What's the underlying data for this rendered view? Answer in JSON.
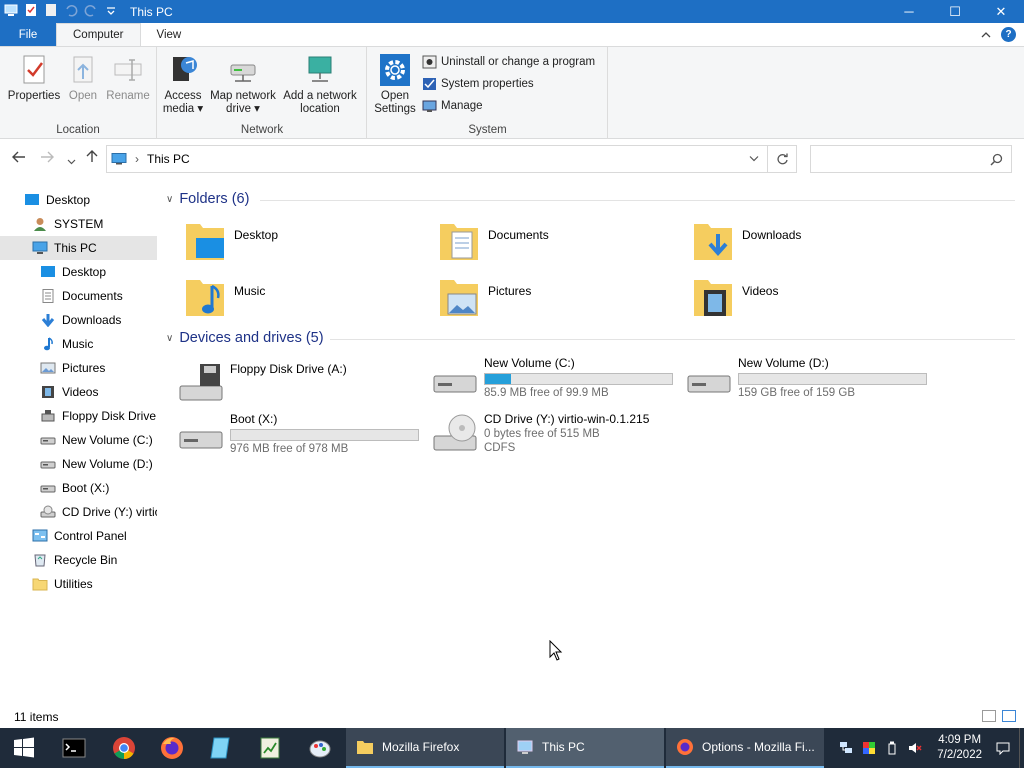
{
  "window": {
    "title": "This PC",
    "controls": {
      "minimize": "─",
      "maximize": "☐",
      "close": "✕"
    }
  },
  "ribbon": {
    "tabs": [
      {
        "label": "File"
      },
      {
        "label": "Computer"
      },
      {
        "label": "View"
      }
    ],
    "groups": {
      "location": {
        "label": "Location",
        "properties": "Properties",
        "open": "Open",
        "rename": "Rename"
      },
      "network": {
        "label": "Network",
        "access_media": [
          "Access",
          "media"
        ],
        "map_network_drive": [
          "Map network",
          "drive"
        ],
        "add_network_location": [
          "Add a network",
          "location"
        ]
      },
      "system": {
        "label": "System",
        "open_settings": [
          "Open",
          "Settings"
        ],
        "uninstall": "Uninstall or change a program",
        "system_properties": "System properties",
        "manage": "Manage"
      }
    }
  },
  "address": {
    "path": "This PC",
    "search_placeholder": ""
  },
  "nav_pane": {
    "items": [
      {
        "label": "Desktop",
        "icon": "desktop-icon"
      },
      {
        "label": "SYSTEM",
        "icon": "user-icon"
      },
      {
        "label": "This PC",
        "icon": "pc-icon",
        "selected": true
      },
      {
        "label": "Desktop",
        "icon": "desktop-icon"
      },
      {
        "label": "Documents",
        "icon": "documents-icon"
      },
      {
        "label": "Downloads",
        "icon": "downloads-icon"
      },
      {
        "label": "Music",
        "icon": "music-icon"
      },
      {
        "label": "Pictures",
        "icon": "pictures-icon"
      },
      {
        "label": "Videos",
        "icon": "videos-icon"
      },
      {
        "label": "Floppy Disk Drive",
        "icon": "floppy-icon"
      },
      {
        "label": "New Volume (C:)",
        "icon": "drive-icon"
      },
      {
        "label": "New Volume (D:)",
        "icon": "drive-icon"
      },
      {
        "label": "Boot (X:)",
        "icon": "drive-icon"
      },
      {
        "label": "CD Drive (Y:) virtio",
        "icon": "cd-drive-icon"
      },
      {
        "label": "Control Panel",
        "icon": "control-panel-icon"
      },
      {
        "label": "Recycle Bin",
        "icon": "recycle-bin-icon"
      },
      {
        "label": "Utilities",
        "icon": "folder-icon"
      }
    ]
  },
  "content": {
    "folders_header": "Folders (6)",
    "folders": [
      {
        "name": "Desktop",
        "icon": "desktop-folder-icon"
      },
      {
        "name": "Documents",
        "icon": "documents-folder-icon"
      },
      {
        "name": "Downloads",
        "icon": "downloads-folder-icon"
      },
      {
        "name": "Music",
        "icon": "music-folder-icon"
      },
      {
        "name": "Pictures",
        "icon": "pictures-folder-icon"
      },
      {
        "name": "Videos",
        "icon": "videos-folder-icon"
      }
    ],
    "drives_header": "Devices and drives (5)",
    "drives": [
      {
        "name": "Floppy Disk Drive (A:)",
        "icon": "floppy-drive-icon"
      },
      {
        "name": "New Volume (C:)",
        "free": "85.9 MB free of 99.9 MB",
        "used_fraction": 0.14,
        "icon": "hard-drive-icon"
      },
      {
        "name": "New Volume (D:)",
        "free": "159 GB free of 159 GB",
        "used_fraction": 0.0,
        "icon": "hard-drive-icon"
      },
      {
        "name": "Boot (X:)",
        "free": "976 MB free of 978 MB",
        "used_fraction": 0.0,
        "icon": "hard-drive-icon"
      },
      {
        "name": "CD Drive (Y:) virtio-win-0.1.215",
        "free": "0 bytes free of 515 MB",
        "fs": "CDFS",
        "icon": "cd-drive-icon"
      }
    ]
  },
  "status": {
    "item_count": "11 items"
  },
  "taskbar": {
    "windows": [
      {
        "label": "Mozilla Firefox",
        "icon": "folder-icon"
      },
      {
        "label": "This PC",
        "icon": "pc-icon",
        "active": true
      },
      {
        "label": "Options - Mozilla Fi...",
        "icon": "firefox-icon"
      }
    ],
    "clock": {
      "time": "4:09 PM",
      "date": "7/2/2022"
    }
  },
  "colors": {
    "accent": "#1e6fc4",
    "drive_bar": "#26a0da",
    "section_header": "#1e3287",
    "taskbar": "#1f2b3a"
  }
}
